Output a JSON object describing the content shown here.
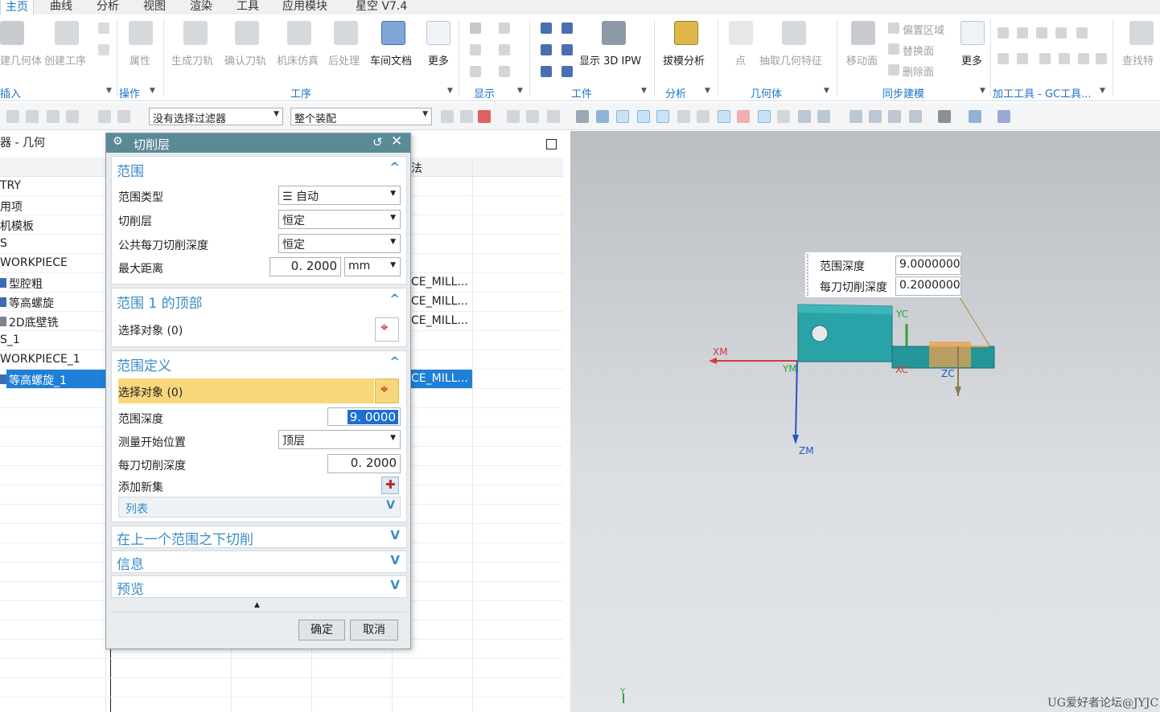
{
  "ribbon": {
    "tabs": [
      "主页",
      "曲线",
      "分析",
      "视图",
      "渲染",
      "工具",
      "应用模块",
      "星空 V7.4"
    ],
    "buttons": {
      "insert_geom": "建几何体",
      "create_op": "创建工序",
      "properties": "属性",
      "gen_path": "生成刀轨",
      "verify": "确认刀轨",
      "machine_sim": "机床仿真",
      "post": "后处理",
      "shop_doc": "车间文档",
      "more1": "更多",
      "show_ipw": "显示 3D IPW",
      "draft": "拔模分析",
      "point": "点",
      "extract": "抽取几何特征",
      "move_face": "移动面",
      "offset_region": "偏置区域",
      "replace_face": "替换面",
      "delete_face": "删除面",
      "more2": "更多",
      "find": "查找特"
    },
    "groups": [
      "插入",
      "操作",
      "工序",
      "显示",
      "工件",
      "分析",
      "几何体",
      "同步建模",
      "加工工具 - GC工具..."
    ]
  },
  "toolbar": {
    "filter": "没有选择过滤器",
    "assembly": "整个装配"
  },
  "navigator": {
    "title": "器 - 几何",
    "column2": "法",
    "rows": [
      {
        "name": "TRY",
        "method": ""
      },
      {
        "name": "用项",
        "method": ""
      },
      {
        "name": "机模板",
        "method": ""
      },
      {
        "name": "S",
        "method": ""
      },
      {
        "name": "WORKPIECE",
        "method": ""
      },
      {
        "name": "型腔粗",
        "method": "CE_MILL..."
      },
      {
        "name": "等高螺旋",
        "method": "CE_MILL..."
      },
      {
        "name": "2D底壁铣",
        "method": "CE_MILL..."
      },
      {
        "name": "S_1",
        "method": ""
      },
      {
        "name": "WORKPIECE_1",
        "method": ""
      },
      {
        "name": "等高螺旋_1",
        "method": "CE_MILL..."
      }
    ]
  },
  "dialog": {
    "title": "切削层",
    "sec_range": "范围",
    "range_type_label": "范围类型",
    "range_type_value": "自动",
    "cut_level_label": "切削层",
    "cut_level_value": "恒定",
    "common_depth_label": "公共每刀切削深度",
    "common_depth_value": "恒定",
    "max_dist_label": "最大距离",
    "max_dist_value": "0. 2000",
    "max_dist_unit": "mm",
    "sec_top": "范围 1 的顶部",
    "select_obj": "选择对象 (0)",
    "sec_def": "范围定义",
    "select_obj2": "选择对象 (0)",
    "range_depth_label": "范围深度",
    "range_depth_value": "9. 0000",
    "measure_label": "测量开始位置",
    "measure_value": "顶层",
    "per_cut_label": "每刀切削深度",
    "per_cut_value": "0. 2000",
    "add_set_label": "添加新集",
    "list_label": "列表",
    "sec_below": "在上一个范围之下切削",
    "sec_info": "信息",
    "sec_preview": "预览",
    "ok": "确定",
    "cancel": "取消"
  },
  "viewport": {
    "tooltip": {
      "depth_label": "范围深度",
      "depth_value": "9.0000000",
      "per_cut_label": "每刀切削深度",
      "per_cut_value": "0.2000000"
    },
    "axes": {
      "xm": "XM",
      "ym": "YM",
      "zm": "ZM",
      "xc": "XC",
      "yc": "YC",
      "zc": "ZC",
      "y": "Y"
    },
    "watermark": "UG爱好者论坛@JYJC"
  },
  "colors": {
    "part": "#2aa3a8",
    "accent": "#1a73c8",
    "dialog_title": "#5b8a97",
    "highlight": "#f8d77a"
  }
}
